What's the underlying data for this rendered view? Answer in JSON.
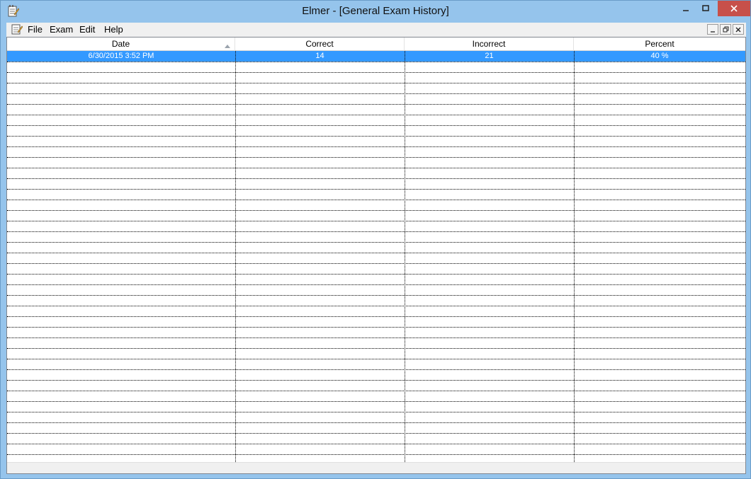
{
  "window": {
    "title": "Elmer - [General Exam History]",
    "app_icon": "notepad-pencil-icon",
    "caption": {
      "minimize": "–",
      "maximize": "☐",
      "close": "✕"
    }
  },
  "menubar": {
    "doc_icon": "document-edit-icon",
    "items": [
      "File",
      "Exam",
      "Edit",
      "Help"
    ],
    "mdi": {
      "minimize": "_",
      "restore": "🗗",
      "close": "×"
    }
  },
  "table": {
    "columns": [
      "Date",
      "Correct",
      "Incorrect",
      "Percent"
    ],
    "sorted_column": "Date",
    "sort_direction": "ascending",
    "rows": [
      {
        "date": "6/30/2015 3:52 PM",
        "correct": "14",
        "incorrect": "21",
        "percent": "40 %"
      }
    ]
  },
  "colors": {
    "selection": "#3399ff",
    "frame": "#95c4ec",
    "close_button": "#c7504a"
  }
}
